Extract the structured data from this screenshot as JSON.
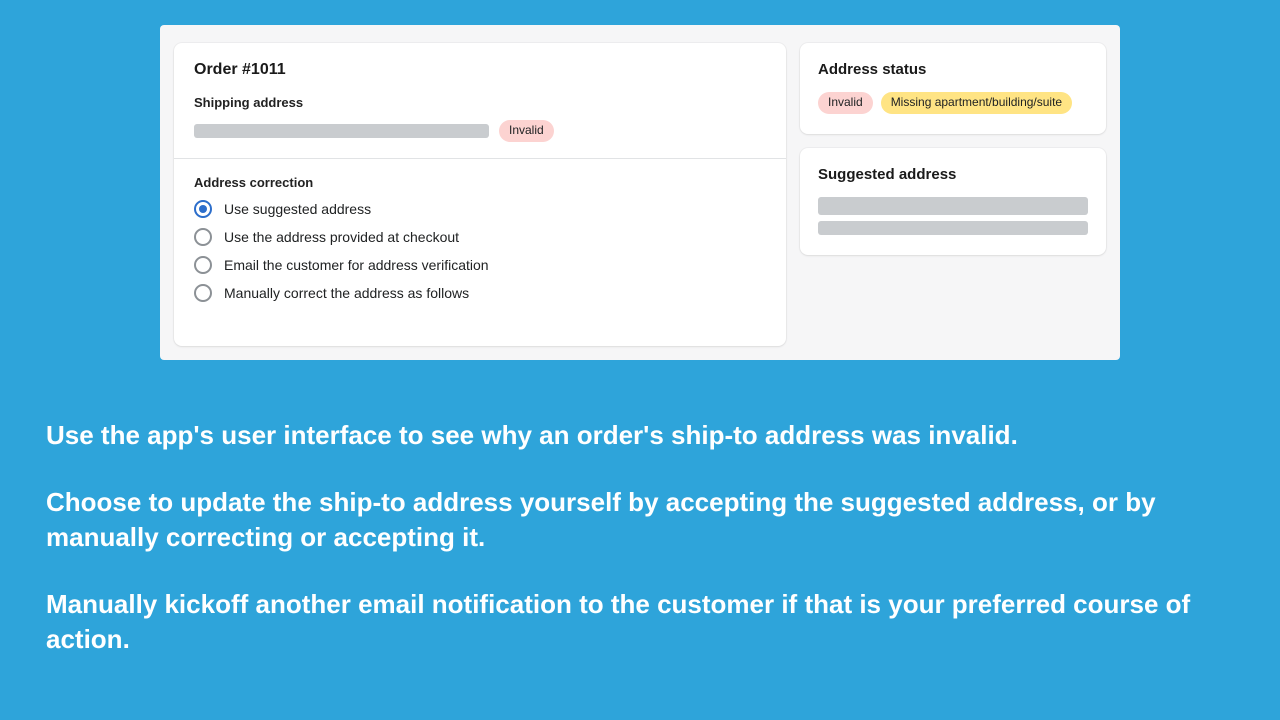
{
  "order": {
    "title": "Order #1011",
    "shipping_label": "Shipping address",
    "invalid_badge": "Invalid"
  },
  "correction": {
    "title": "Address correction",
    "options": [
      "Use suggested address",
      "Use the address provided at checkout",
      "Email the customer for address verification",
      "Manually correct the address as follows"
    ],
    "selected_index": 0
  },
  "status": {
    "title": "Address status",
    "badges": {
      "invalid": "Invalid",
      "missing": "Missing apartment/building/suite"
    }
  },
  "suggested": {
    "title": "Suggested address"
  },
  "caption": {
    "p1": "Use the app's user interface to see why an order's ship-to address was invalid.",
    "p2": "Choose to update the ship-to address yourself by accepting the suggested address, or by manually correcting or accepting it.",
    "p3": "Manually kickoff another email notification to the customer if that is your preferred course of action."
  }
}
